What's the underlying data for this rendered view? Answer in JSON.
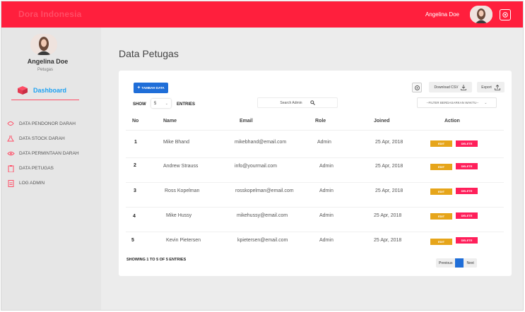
{
  "brand": "Dora Indonesia",
  "top_user": {
    "name": "Angelina Doe"
  },
  "sidebar": {
    "name": "Angelina Doe",
    "role": "Petugas",
    "dashboard": "Dashboard",
    "items": [
      {
        "label": "DATA PENDONOR DARAH",
        "icon": "blood-drop-icon"
      },
      {
        "label": "DATA STOCK DARAH",
        "icon": "flask-icon"
      },
      {
        "label": "DATA PERMINTAAN DARAH",
        "icon": "eye-icon"
      },
      {
        "label": "DATA PETUGAS",
        "icon": "clipboard-icon"
      },
      {
        "label": "LOG ADMIN",
        "icon": "document-icon"
      }
    ]
  },
  "page_title": "Data Petugas",
  "toolbar": {
    "add_label": "TAMBAH DATA",
    "csv_label": "Download CSV",
    "export_label": "Export",
    "show_label": "SHOW",
    "show_value": "5",
    "entries_label": "ENTRIES",
    "search_placeholder": "Search Admin",
    "filter_label": "--FILTER BERDASARKAN WAKTU--"
  },
  "table": {
    "headers": [
      "No",
      "Name",
      "Email",
      "Role",
      "Joined",
      "Action"
    ],
    "edit_label": "EDIT",
    "delete_label": "DELETE",
    "rows": [
      {
        "no": "1",
        "name": "Mike Bhand",
        "email": "mikebhand@email.com",
        "role": "Admin",
        "joined": "25 Apr, 2018"
      },
      {
        "no": "2",
        "name": "Andrew Strauss",
        "email": "info@yourmail.com",
        "role": "Admin",
        "joined": "25 Apr, 2018"
      },
      {
        "no": "3",
        "name": "Ross Kopelman",
        "email": "rosskopelman@email.com",
        "role": "Admin",
        "joined": "25 Apr, 2018"
      },
      {
        "no": "4",
        "name": "Mike Hussy",
        "email": "mikehussy@email.com",
        "role": "Admin",
        "joined": "25 Apr, 2018"
      },
      {
        "no": "5",
        "name": "Kevin Pietersen",
        "email": "kpietersen@email.com",
        "role": "Admin",
        "joined": "25 Apr, 2018"
      }
    ]
  },
  "footer": {
    "showing": "SHOWING 1 TO 5 OF 5 ENTRIES",
    "prev": "Previous",
    "page": "1",
    "next": "Next"
  },
  "colors": {
    "topbar": "#ff1f3d",
    "primary": "#1f6ed8",
    "edit": "#e6a51a",
    "delete": "#ff1f5a",
    "accent": "#1da1f2"
  }
}
